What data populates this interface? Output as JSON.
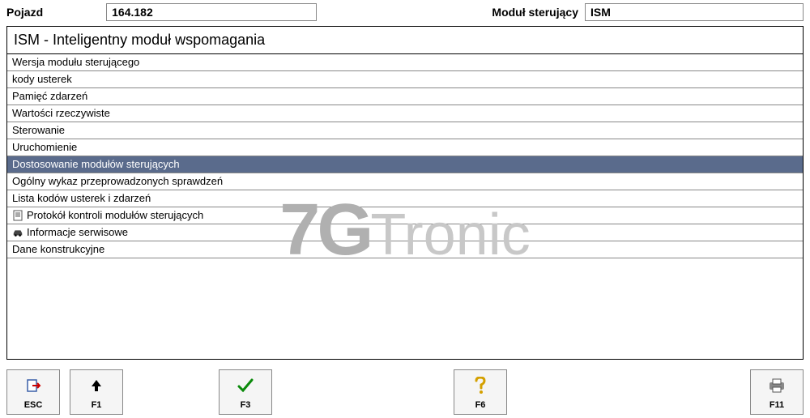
{
  "header": {
    "vehicle_label": "Pojazd",
    "vehicle_value": "164.182",
    "module_label": "Moduł sterujący",
    "module_value": "ISM"
  },
  "panel": {
    "title": "ISM - Inteligentny moduł wspomagania"
  },
  "menu": {
    "items": [
      {
        "label": "Wersja modułu sterującego",
        "icon": "",
        "selected": false
      },
      {
        "label": "kody usterek",
        "icon": "",
        "selected": false
      },
      {
        "label": "Pamięć zdarzeń",
        "icon": "",
        "selected": false
      },
      {
        "label": "Wartości rzeczywiste",
        "icon": "",
        "selected": false
      },
      {
        "label": "Sterowanie",
        "icon": "",
        "selected": false
      },
      {
        "label": "Uruchomienie",
        "icon": "",
        "selected": false
      },
      {
        "label": "Dostosowanie modułów sterujących",
        "icon": "",
        "selected": true
      },
      {
        "label": "Ogólny wykaz przeprowadzonych sprawdzeń",
        "icon": "",
        "selected": false
      },
      {
        "label": "Lista kodów usterek i zdarzeń",
        "icon": "",
        "selected": false
      },
      {
        "label": "Protokół kontroli modułów sterujących",
        "icon": "document",
        "selected": false
      },
      {
        "label": "Informacje serwisowe",
        "icon": "car",
        "selected": false
      },
      {
        "label": "Dane konstrukcyjne",
        "icon": "",
        "selected": false
      }
    ]
  },
  "watermark": {
    "bold": "7G",
    "light": "Tronic"
  },
  "footer": {
    "esc": "ESC",
    "f1": "F1",
    "f3": "F3",
    "f6": "F6",
    "f11": "F11"
  }
}
